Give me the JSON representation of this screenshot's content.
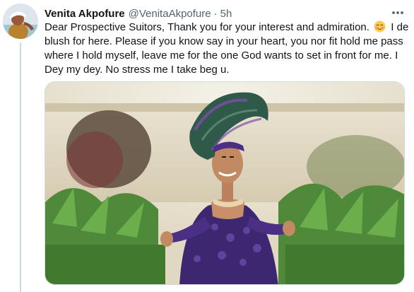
{
  "tweet": {
    "author": {
      "display_name": "Venita Akpofure",
      "handle": "@VenitaAkpofure",
      "avatar_icon": "profile-photo"
    },
    "separator": "·",
    "timestamp": "5h",
    "more_icon": "more-dots-icon",
    "text_lines": {
      "part1": "Dear Prospective Suitors, Thank you for your interest and admiration. ",
      "emoji": "blushing-face",
      "part2": " I de blush for here. Please if you know say in your heart, you nor fit hold me pass where I hold myself, leave me for the one God wants to set in front for me. I Dey my dey. No stress me I take beg u."
    },
    "media": {
      "kind": "photo",
      "subject_icon": "woman-in-purple-gele-photo"
    }
  },
  "colors": {
    "text_primary": "#0f1419",
    "text_secondary": "#536471",
    "thread_line": "#cfd9de",
    "dress_purple": "#4b2f84",
    "gele_green": "#2f5a4a"
  }
}
